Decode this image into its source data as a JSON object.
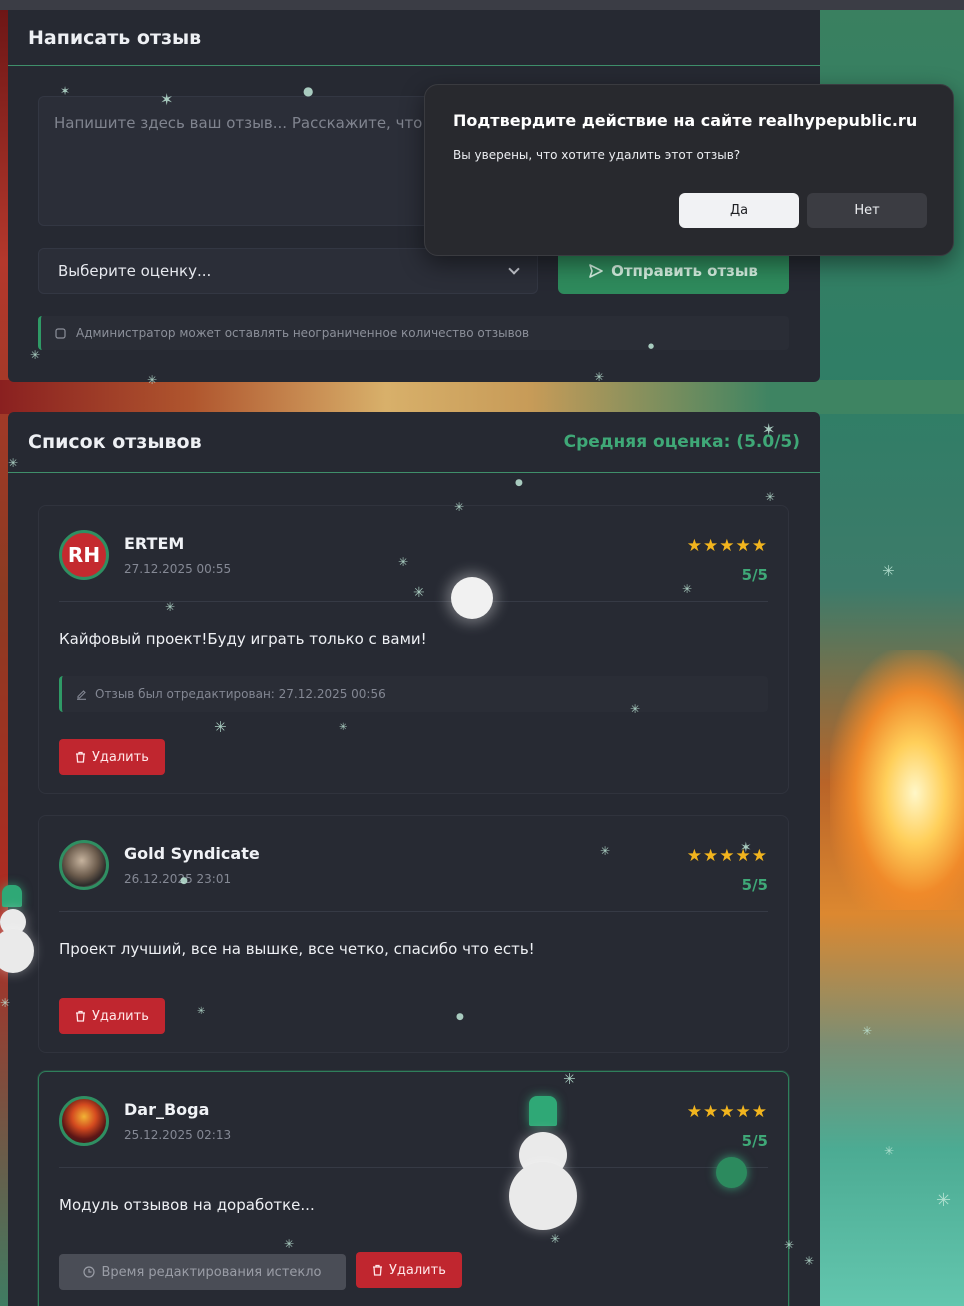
{
  "write_panel": {
    "title": "Написать отзыв",
    "textarea_placeholder": "Напишите здесь ваш отзыв... Расскажите, что улучшить.",
    "select_value": "Выберите оценку...",
    "submit_label": "Отправить отзыв",
    "admin_note": "Администратор может оставлять неограниченное количество отзывов"
  },
  "list_panel": {
    "title": "Список отзывов",
    "average": "Средняя оценка: (5.0/5)"
  },
  "reviews": [
    {
      "author": "ERTEM",
      "date": "27.12.2025 00:55",
      "stars": "★★★★★",
      "score": "5/5",
      "text": "Кайфовый проект!Буду играть только с вами!",
      "edited_note": "Отзыв был отредактирован: 27.12.2025 00:56",
      "avatar_text": "RH",
      "delete_label": "Удалить"
    },
    {
      "author": "Gold Syndicate",
      "date": "26.12.2025 23:01",
      "stars": "★★★★★",
      "score": "5/5",
      "text": "Проект лучший, все на вышке, все четко, спасибо что есть!",
      "delete_label": "Удалить"
    },
    {
      "author": "Dar_Boga",
      "date": "25.12.2025 02:13",
      "stars": "★★★★★",
      "score": "5/5",
      "text": "Модуль отзывов на доработке...",
      "expired_label": "Время редактирования истекло",
      "delete_label": "Удалить"
    }
  ],
  "dialog": {
    "title": "Подтвердите действие на сайте realhypepublic.ru",
    "message": "Вы уверены, что хотите удалить этот отзыв?",
    "yes_label": "Да",
    "no_label": "Нет"
  },
  "colors": {
    "accent": "#2e8a5c",
    "danger": "#c0262f",
    "stars": "#f2b51e",
    "panel": "#262932"
  },
  "icons": [
    "send-icon",
    "info-icon",
    "chevron-down-icon",
    "trash-icon",
    "edit-icon",
    "clock-icon"
  ]
}
